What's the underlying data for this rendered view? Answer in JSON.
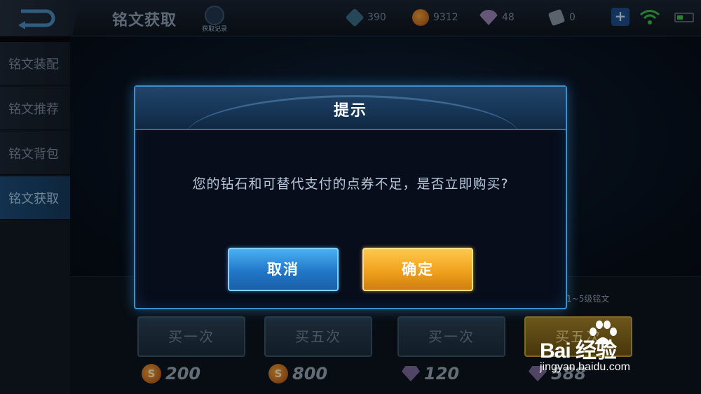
{
  "header": {
    "title": "铭文获取",
    "record_label": "获取记录",
    "currencies": [
      {
        "name": "exp",
        "icon": "cube-icon",
        "value": "390",
        "color": "#3b6d86"
      },
      {
        "name": "gold",
        "icon": "gold-coin-icon",
        "value": "9312",
        "color": "#e07a1c"
      },
      {
        "name": "diamond",
        "icon": "diamond-icon",
        "value": "48",
        "color": "#9a86b8"
      },
      {
        "name": "voucher",
        "icon": "voucher-icon",
        "value": "0",
        "color": "#8a97a6"
      }
    ]
  },
  "sidebar": {
    "items": [
      {
        "label": "铭文装配",
        "active": false
      },
      {
        "label": "铭文推荐",
        "active": false
      },
      {
        "label": "铭文背包",
        "active": false
      },
      {
        "label": "铭文获取",
        "active": true
      }
    ]
  },
  "shop": {
    "tier_label": "1~5级铭文",
    "buttons": [
      {
        "label": "买一次",
        "price": "200",
        "currency_icon": "gold-coin-icon"
      },
      {
        "label": "买五次",
        "price": "800",
        "currency_icon": "gold-coin-icon"
      },
      {
        "label": "买一次",
        "price": "120",
        "currency_icon": "diamond-icon"
      },
      {
        "label": "买五次",
        "price": "588",
        "currency_icon": "diamond-icon"
      }
    ]
  },
  "dialog": {
    "title": "提示",
    "message": "您的钻石和可替代支付的点券不足，是否立即购买?",
    "cancel_label": "取消",
    "confirm_label": "确定"
  },
  "watermark": {
    "logo_text": "Bai 经验",
    "url": "jingyan.baidu.com"
  },
  "colors": {
    "dialog_border": "#3a8fce",
    "cancel_button": "#2277c9",
    "confirm_button": "#f0a11c"
  }
}
